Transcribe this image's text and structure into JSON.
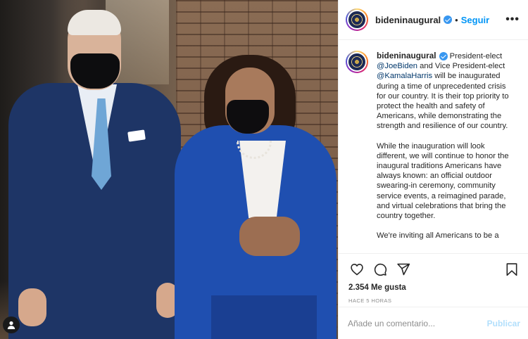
{
  "post": {
    "username": "bideninaugural",
    "follow_label": "Seguir",
    "separator": "•",
    "more_label": "•••"
  },
  "caption": {
    "username": "bideninaugural",
    "p1_pre": " President-elect ",
    "mention1": "@JoeBiden",
    "p1_mid": " and Vice President-elect ",
    "mention2": "@KamalaHarris",
    "p1_post": " will be inaugurated during a time of unprecedented crisis for our country. It is their top priority to protect the health and safety of Americans, while demonstrating the strength and resilience of our country.",
    "p2": "While the inauguration will look different, we will continue to honor the inaugural traditions Americans have always known: an official outdoor swearing-in ceremony, community service events, a reimagined parade, and virtual celebrations that bring the country together.",
    "p3": "We're inviting all Americans to be a"
  },
  "actions": {
    "icons": [
      "heart-icon",
      "comment-icon",
      "share-icon",
      "bookmark-icon"
    ],
    "likes": "2.354 Me gusta",
    "time": "HACE 5 HORAS"
  },
  "comment": {
    "placeholder": "Añade un comentario...",
    "publish_label": "Publicar"
  },
  "colors": {
    "accent": "#0095f6",
    "verified": "#3897f0",
    "publish_disabled": "#b2dffc",
    "mention": "#00376b"
  }
}
